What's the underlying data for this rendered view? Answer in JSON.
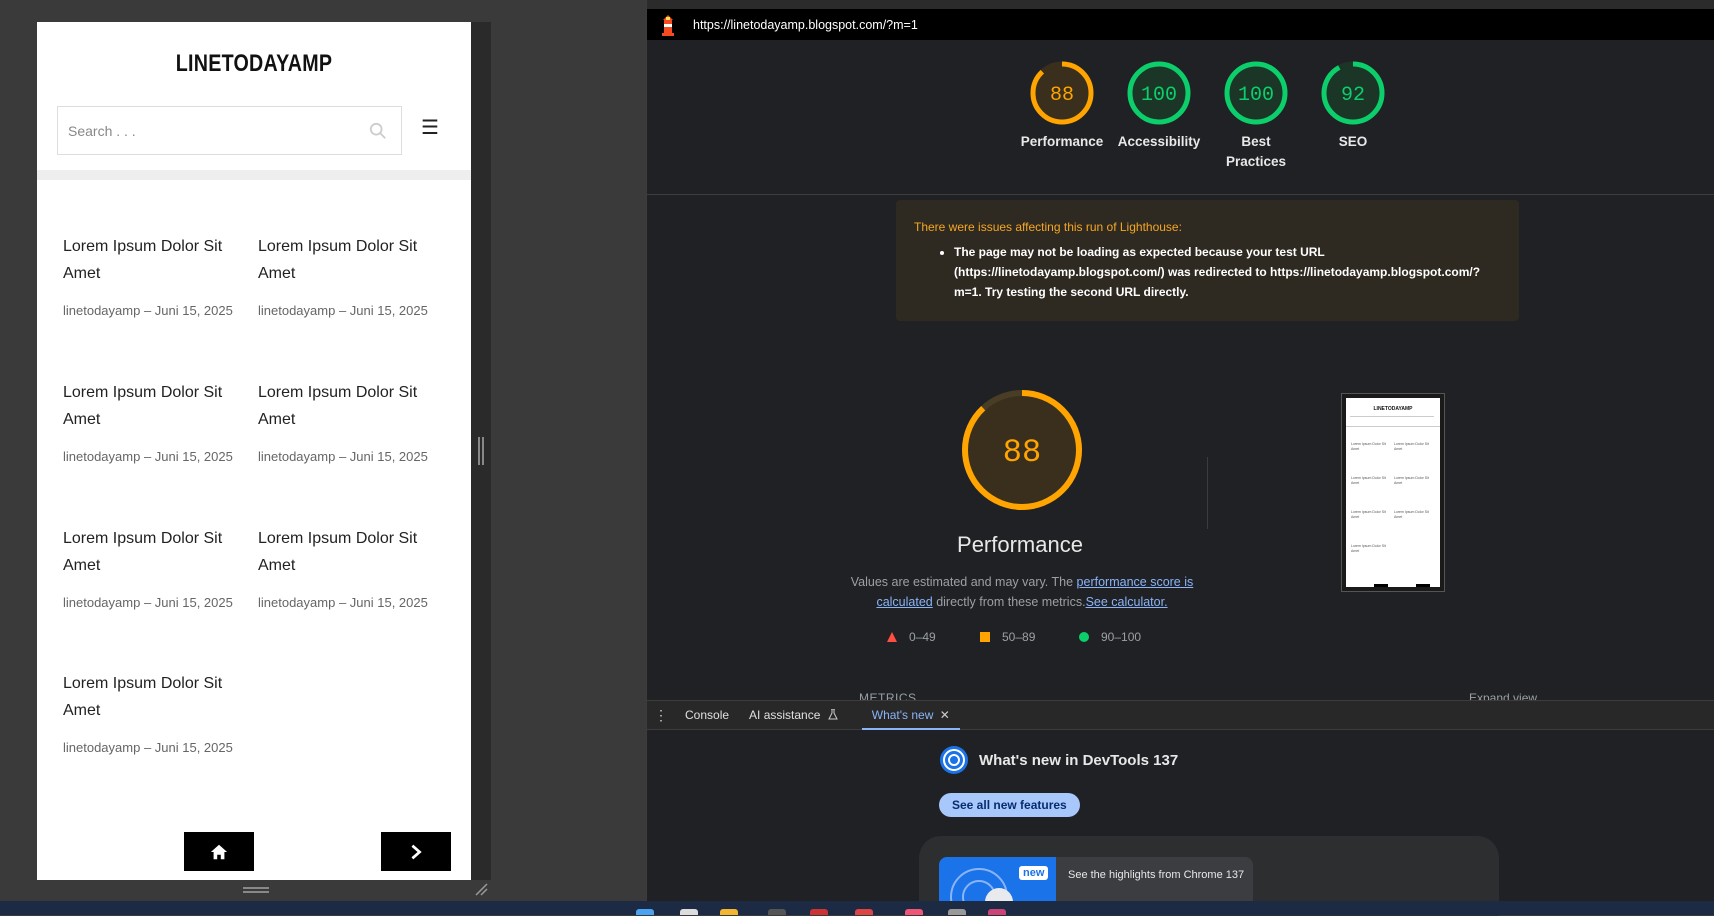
{
  "device": {
    "site_title": "LINETODAYAMP",
    "search_placeholder": "Search . . .",
    "menu_glyph": "☰",
    "posts": [
      {
        "title": "Lorem Ipsum Dolor Sit Amet",
        "meta": "linetodayamp – Juni 15, 2025"
      },
      {
        "title": "Lorem Ipsum Dolor Sit Amet",
        "meta": "linetodayamp – Juni 15, 2025"
      },
      {
        "title": "Lorem Ipsum Dolor Sit Amet",
        "meta": "linetodayamp – Juni 15, 2025"
      },
      {
        "title": "Lorem Ipsum Dolor Sit Amet",
        "meta": "linetodayamp – Juni 15, 2025"
      },
      {
        "title": "Lorem Ipsum Dolor Sit Amet",
        "meta": "linetodayamp – Juni 15, 2025"
      },
      {
        "title": "Lorem Ipsum Dolor Sit Amet",
        "meta": "linetodayamp – Juni 15, 2025"
      },
      {
        "title": "Lorem Ipsum Dolor Sit Amet",
        "meta": "linetodayamp – Juni 15, 2025"
      }
    ]
  },
  "devtools": {
    "url": "https://linetodayamp.blogspot.com/?m=1",
    "scores": [
      {
        "label": "Performance",
        "value": "88",
        "color": "#ffa400",
        "fill": "#3a2f1c"
      },
      {
        "label": "Accessibility",
        "value": "100",
        "color": "#0cce6b",
        "fill": "#1b3526"
      },
      {
        "label": "Best Practices",
        "value": "100",
        "color": "#0cce6b",
        "fill": "#1b3526"
      },
      {
        "label": "SEO",
        "value": "92",
        "color": "#0cce6b",
        "fill": "#1b3526"
      }
    ],
    "warning": {
      "title": "There were issues affecting this run of Lighthouse:",
      "item": "The page may not be loading as expected because your test URL (https://linetodayamp.blogspot.com/) was redirected to https://linetodayamp.blogspot.com/?m=1. Try testing the second URL directly."
    },
    "performance": {
      "score": "88",
      "title": "Performance",
      "desc_prefix": "Values are estimated and may vary. The ",
      "desc_link": "performance score is calculated",
      "desc_mid": " directly from these metrics.",
      "desc_link2": "See calculator."
    },
    "legend": [
      {
        "range": "0–49",
        "color": "#ff4e42",
        "shape": "triangle"
      },
      {
        "range": "50–89",
        "color": "#ffa400",
        "shape": "square"
      },
      {
        "range": "90–100",
        "color": "#0cce6b",
        "shape": "circle"
      }
    ],
    "metrics_label": "METRICS",
    "expand_view": "Expand view",
    "drawer": {
      "tabs": [
        "Console",
        "AI assistance",
        "What's new"
      ],
      "active": "What's new"
    },
    "whats_new": {
      "heading": "What's new in DevTools 137",
      "button": "See all new features",
      "badge": "new",
      "card_text": "See the highlights from Chrome 137"
    }
  }
}
